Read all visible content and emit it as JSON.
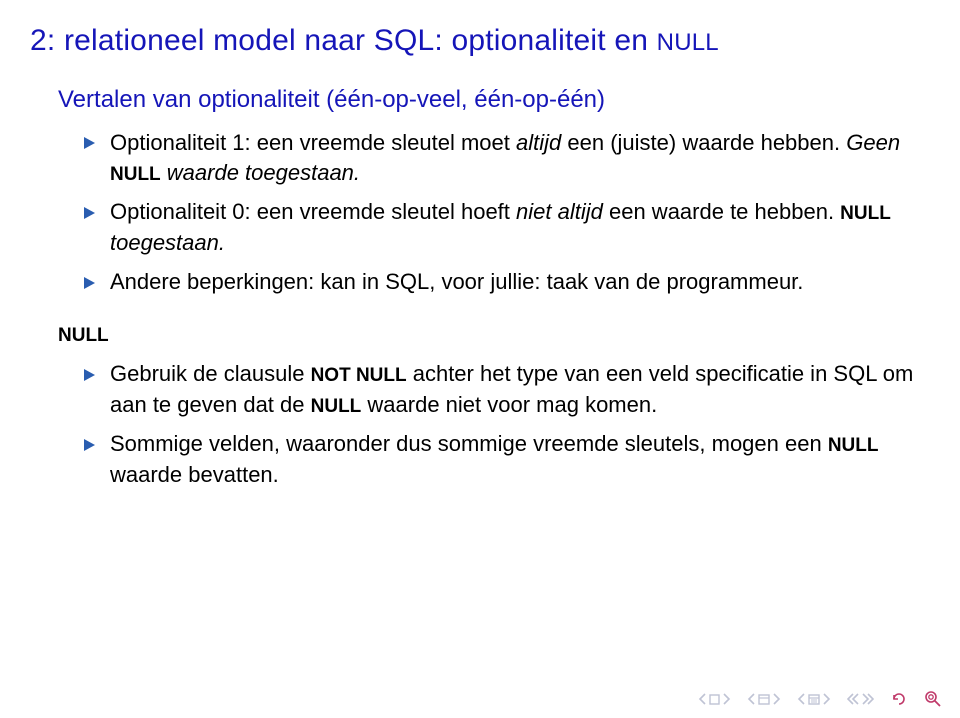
{
  "title": {
    "prefix": "2: relationeel model naar SQL: optionaliteit en ",
    "null_word": "NULL"
  },
  "subhead": "Vertalen van optionaliteit (één-op-veel, één-op-één)",
  "bullets1": [
    {
      "pre": "Optionaliteit 1: een vreemde sleutel moet ",
      "em": "altijd",
      "post1": " een (juiste) waarde hebben. ",
      "em2": "Geen ",
      "kw": "NULL",
      "post2": " waarde toegestaan."
    },
    {
      "pre": "Optionaliteit 0: een vreemde sleutel hoeft ",
      "em": "niet altijd",
      "post1": " een waarde te hebben. ",
      "kw": "NULL",
      "post2": " toegestaan."
    },
    {
      "plain": "Andere beperkingen: kan in SQL, voor jullie: taak van de programmeur."
    }
  ],
  "null_heading": "NULL",
  "bullets2": [
    {
      "pre": "Gebruik de clausule ",
      "kw": "NOT NULL",
      "mid": " achter het type van een veld specificatie in SQL om aan te geven dat de ",
      "kw2": "NULL",
      "post": " waarde niet voor mag komen."
    },
    {
      "pre": "Sommige velden, waaronder dus sommige vreemde sleutels, mogen een ",
      "kw": "NULL",
      "post": " waarde bevatten."
    }
  ]
}
